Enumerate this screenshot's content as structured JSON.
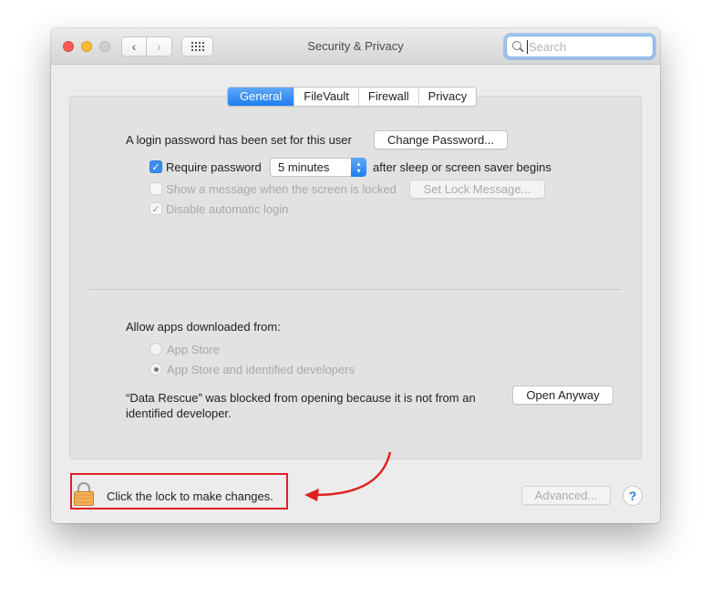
{
  "window": {
    "title": "Security & Privacy",
    "search": {
      "placeholder": "Search",
      "value": ""
    }
  },
  "tabs": [
    {
      "label": "General",
      "active": true
    },
    {
      "label": "FileVault",
      "active": false
    },
    {
      "label": "Firewall",
      "active": false
    },
    {
      "label": "Privacy",
      "active": false
    }
  ],
  "general": {
    "login_password_text": "A login password has been set for this user",
    "change_password_button": "Change Password...",
    "require_password": {
      "label": "Require password",
      "checked": true,
      "interval": "5 minutes",
      "suffix": "after sleep or screen saver begins"
    },
    "show_message": {
      "label": "Show a message when the screen is locked",
      "checked": false,
      "enabled": false,
      "button": "Set Lock Message..."
    },
    "disable_auto_login": {
      "label": "Disable automatic login",
      "checked": true,
      "enabled": false
    },
    "allow_apps": {
      "heading": "Allow apps downloaded from:",
      "options": [
        {
          "label": "App Store",
          "selected": false
        },
        {
          "label": "App Store and identified developers",
          "selected": true
        }
      ]
    },
    "blocked_message": "“Data Rescue” was blocked from opening because it is not from an identified developer.",
    "open_anyway_button": "Open Anyway"
  },
  "footer": {
    "lock_text": "Click the lock to make changes.",
    "advanced_button": "Advanced...",
    "help_button": "?"
  },
  "annotation": {
    "highlight_color": "#e02020"
  },
  "colors": {
    "accent": "#1c7ef0",
    "close": "#fc5b57",
    "minimize": "#fdbc2e"
  }
}
